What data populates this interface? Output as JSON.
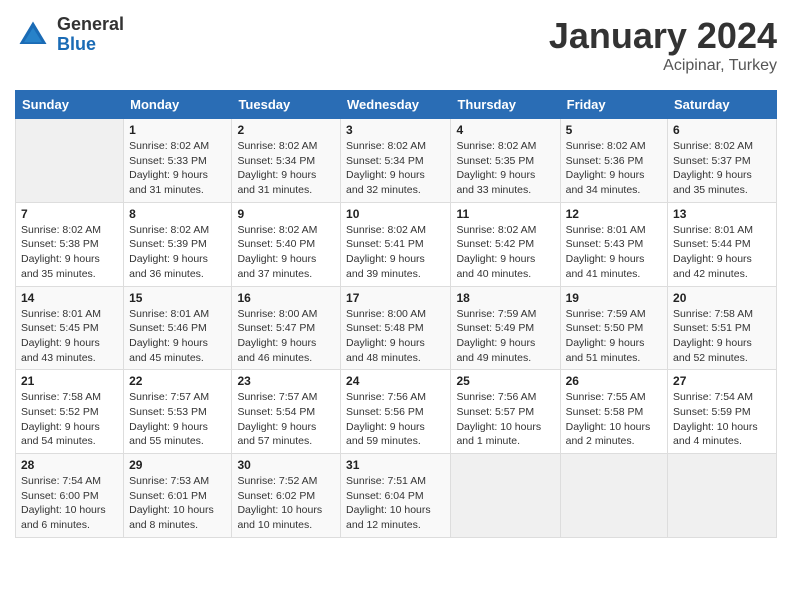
{
  "logo": {
    "general": "General",
    "blue": "Blue"
  },
  "header": {
    "month": "January 2024",
    "location": "Acipinar, Turkey"
  },
  "weekdays": [
    "Sunday",
    "Monday",
    "Tuesday",
    "Wednesday",
    "Thursday",
    "Friday",
    "Saturday"
  ],
  "weeks": [
    [
      {
        "day": "",
        "info": ""
      },
      {
        "day": "1",
        "info": "Sunrise: 8:02 AM\nSunset: 5:33 PM\nDaylight: 9 hours\nand 31 minutes."
      },
      {
        "day": "2",
        "info": "Sunrise: 8:02 AM\nSunset: 5:34 PM\nDaylight: 9 hours\nand 31 minutes."
      },
      {
        "day": "3",
        "info": "Sunrise: 8:02 AM\nSunset: 5:34 PM\nDaylight: 9 hours\nand 32 minutes."
      },
      {
        "day": "4",
        "info": "Sunrise: 8:02 AM\nSunset: 5:35 PM\nDaylight: 9 hours\nand 33 minutes."
      },
      {
        "day": "5",
        "info": "Sunrise: 8:02 AM\nSunset: 5:36 PM\nDaylight: 9 hours\nand 34 minutes."
      },
      {
        "day": "6",
        "info": "Sunrise: 8:02 AM\nSunset: 5:37 PM\nDaylight: 9 hours\nand 35 minutes."
      }
    ],
    [
      {
        "day": "7",
        "info": "Sunrise: 8:02 AM\nSunset: 5:38 PM\nDaylight: 9 hours\nand 35 minutes."
      },
      {
        "day": "8",
        "info": "Sunrise: 8:02 AM\nSunset: 5:39 PM\nDaylight: 9 hours\nand 36 minutes."
      },
      {
        "day": "9",
        "info": "Sunrise: 8:02 AM\nSunset: 5:40 PM\nDaylight: 9 hours\nand 37 minutes."
      },
      {
        "day": "10",
        "info": "Sunrise: 8:02 AM\nSunset: 5:41 PM\nDaylight: 9 hours\nand 39 minutes."
      },
      {
        "day": "11",
        "info": "Sunrise: 8:02 AM\nSunset: 5:42 PM\nDaylight: 9 hours\nand 40 minutes."
      },
      {
        "day": "12",
        "info": "Sunrise: 8:01 AM\nSunset: 5:43 PM\nDaylight: 9 hours\nand 41 minutes."
      },
      {
        "day": "13",
        "info": "Sunrise: 8:01 AM\nSunset: 5:44 PM\nDaylight: 9 hours\nand 42 minutes."
      }
    ],
    [
      {
        "day": "14",
        "info": "Sunrise: 8:01 AM\nSunset: 5:45 PM\nDaylight: 9 hours\nand 43 minutes."
      },
      {
        "day": "15",
        "info": "Sunrise: 8:01 AM\nSunset: 5:46 PM\nDaylight: 9 hours\nand 45 minutes."
      },
      {
        "day": "16",
        "info": "Sunrise: 8:00 AM\nSunset: 5:47 PM\nDaylight: 9 hours\nand 46 minutes."
      },
      {
        "day": "17",
        "info": "Sunrise: 8:00 AM\nSunset: 5:48 PM\nDaylight: 9 hours\nand 48 minutes."
      },
      {
        "day": "18",
        "info": "Sunrise: 7:59 AM\nSunset: 5:49 PM\nDaylight: 9 hours\nand 49 minutes."
      },
      {
        "day": "19",
        "info": "Sunrise: 7:59 AM\nSunset: 5:50 PM\nDaylight: 9 hours\nand 51 minutes."
      },
      {
        "day": "20",
        "info": "Sunrise: 7:58 AM\nSunset: 5:51 PM\nDaylight: 9 hours\nand 52 minutes."
      }
    ],
    [
      {
        "day": "21",
        "info": "Sunrise: 7:58 AM\nSunset: 5:52 PM\nDaylight: 9 hours\nand 54 minutes."
      },
      {
        "day": "22",
        "info": "Sunrise: 7:57 AM\nSunset: 5:53 PM\nDaylight: 9 hours\nand 55 minutes."
      },
      {
        "day": "23",
        "info": "Sunrise: 7:57 AM\nSunset: 5:54 PM\nDaylight: 9 hours\nand 57 minutes."
      },
      {
        "day": "24",
        "info": "Sunrise: 7:56 AM\nSunset: 5:56 PM\nDaylight: 9 hours\nand 59 minutes."
      },
      {
        "day": "25",
        "info": "Sunrise: 7:56 AM\nSunset: 5:57 PM\nDaylight: 10 hours\nand 1 minute."
      },
      {
        "day": "26",
        "info": "Sunrise: 7:55 AM\nSunset: 5:58 PM\nDaylight: 10 hours\nand 2 minutes."
      },
      {
        "day": "27",
        "info": "Sunrise: 7:54 AM\nSunset: 5:59 PM\nDaylight: 10 hours\nand 4 minutes."
      }
    ],
    [
      {
        "day": "28",
        "info": "Sunrise: 7:54 AM\nSunset: 6:00 PM\nDaylight: 10 hours\nand 6 minutes."
      },
      {
        "day": "29",
        "info": "Sunrise: 7:53 AM\nSunset: 6:01 PM\nDaylight: 10 hours\nand 8 minutes."
      },
      {
        "day": "30",
        "info": "Sunrise: 7:52 AM\nSunset: 6:02 PM\nDaylight: 10 hours\nand 10 minutes."
      },
      {
        "day": "31",
        "info": "Sunrise: 7:51 AM\nSunset: 6:04 PM\nDaylight: 10 hours\nand 12 minutes."
      },
      {
        "day": "",
        "info": ""
      },
      {
        "day": "",
        "info": ""
      },
      {
        "day": "",
        "info": ""
      }
    ]
  ]
}
